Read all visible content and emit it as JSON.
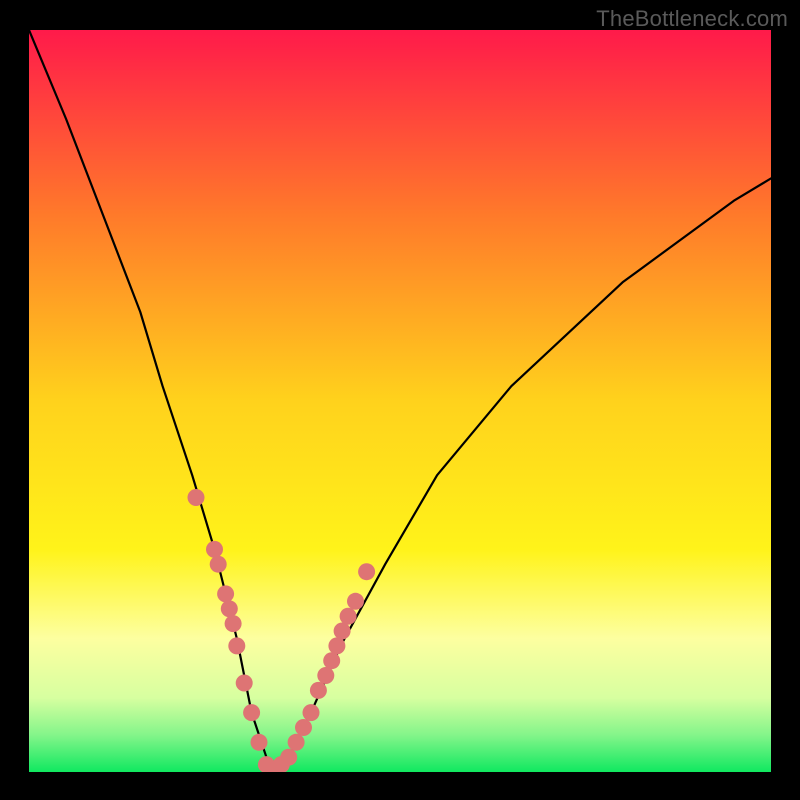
{
  "watermark": "TheBottleneck.com",
  "chart_data": {
    "type": "line",
    "title": "",
    "xlabel": "",
    "ylabel": "",
    "xlim": [
      0,
      100
    ],
    "ylim": [
      0,
      100
    ],
    "grid": false,
    "curve_description": "V-shaped bottleneck curve over vertical red-to-green gradient; minimum near x≈33",
    "series": [
      {
        "name": "bottleneck-curve",
        "x": [
          0,
          5,
          10,
          15,
          18,
          22,
          25,
          28,
          30,
          32,
          33,
          35,
          38,
          42,
          48,
          55,
          65,
          80,
          95,
          100
        ],
        "y": [
          100,
          88,
          75,
          62,
          52,
          40,
          30,
          18,
          8,
          2,
          0,
          2,
          8,
          17,
          28,
          40,
          52,
          66,
          77,
          80
        ]
      }
    ],
    "marker_points": {
      "name": "highlighted-points",
      "color": "#de7474",
      "x": [
        22.5,
        25.0,
        25.5,
        26.5,
        27.0,
        27.5,
        28.0,
        29.0,
        30.0,
        31.0,
        32.0,
        33.0,
        34.0,
        35.0,
        36.0,
        37.0,
        38.0,
        39.0,
        40.0,
        40.8,
        41.5,
        42.2,
        43.0,
        44.0,
        45.5
      ],
      "y": [
        37,
        30,
        28,
        24,
        22,
        20,
        17,
        12,
        8,
        4,
        1,
        0,
        1,
        2,
        4,
        6,
        8,
        11,
        13,
        15,
        17,
        19,
        21,
        23,
        27
      ]
    },
    "gradient_stops": [
      {
        "offset": 0.0,
        "color": "#ff1a4a"
      },
      {
        "offset": 0.25,
        "color": "#ff7a2a"
      },
      {
        "offset": 0.5,
        "color": "#ffd21c"
      },
      {
        "offset": 0.7,
        "color": "#fff31a"
      },
      {
        "offset": 0.82,
        "color": "#fdffa0"
      },
      {
        "offset": 0.9,
        "color": "#d7ffa0"
      },
      {
        "offset": 0.95,
        "color": "#84f58a"
      },
      {
        "offset": 1.0,
        "color": "#10e860"
      }
    ]
  }
}
